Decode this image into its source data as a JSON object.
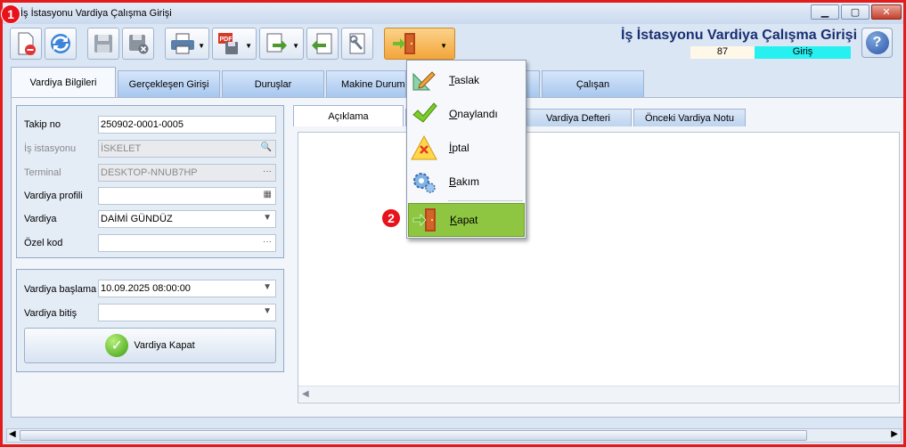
{
  "window": {
    "title": "İş İstasyonu Vardiya Çalışma Girişi",
    "minimize": "▁",
    "maximize": "▢",
    "close": "✕"
  },
  "header": {
    "form_title": "İş İstasyonu Vardiya Çalışma Girişi",
    "status_number": "87",
    "status_text": "Giriş",
    "help_label": "?"
  },
  "toolbar": {
    "buttons": [
      "new-doc-icon",
      "refresh-icon",
      "save-icon",
      "save-delete-icon",
      "print-icon",
      "pdf-save-icon",
      "export-icon",
      "import-icon",
      "tools-icon",
      "door-exit-icon"
    ]
  },
  "tabs": [
    "Vardiya Bilgileri",
    "Gerçekleşen Girişi",
    "Duruşlar",
    "Makine Durumları",
    "",
    "Çalışan"
  ],
  "form": {
    "takip_label": "Takip no",
    "takip_value": "250902-0001-0005",
    "istasyon_label": "İş istasyonu",
    "istasyon_value": "İSKELET",
    "terminal_label": "Terminal",
    "terminal_value": "DESKTOP-NNUB7HP",
    "profil_label": "Vardiya profili",
    "profil_value": "",
    "vardiya_label": "Vardiya",
    "vardiya_value": "DAİMİ GÜNDÜZ",
    "ozel_label": "Özel kod",
    "ozel_value": "",
    "baslama_label": "Vardiya başlama",
    "baslama_value": "10.09.2025 08:00:00",
    "bitis_label": "Vardiya bitiş",
    "bitis_value": " .  .      :  :",
    "kapat_label": "Vardiya Kapat"
  },
  "subtabs": [
    "Açıklama",
    "",
    "Vardiya Defteri",
    "Önceki Vardiya Notu"
  ],
  "dropdown": {
    "items": [
      {
        "accel": "T",
        "rest": "aslak"
      },
      {
        "accel": "O",
        "rest": "naylandı"
      },
      {
        "accel": "İ",
        "rest": "ptal"
      },
      {
        "accel": "B",
        "rest": "akım"
      },
      {
        "accel": "K",
        "rest": "apat"
      }
    ]
  },
  "annotations": {
    "badge1": "1",
    "badge2": "2"
  },
  "colors": {
    "accent": "#1a2f73",
    "status": "#26f0f0",
    "highlight": "#8ec641",
    "marker": "#e31b1b"
  }
}
